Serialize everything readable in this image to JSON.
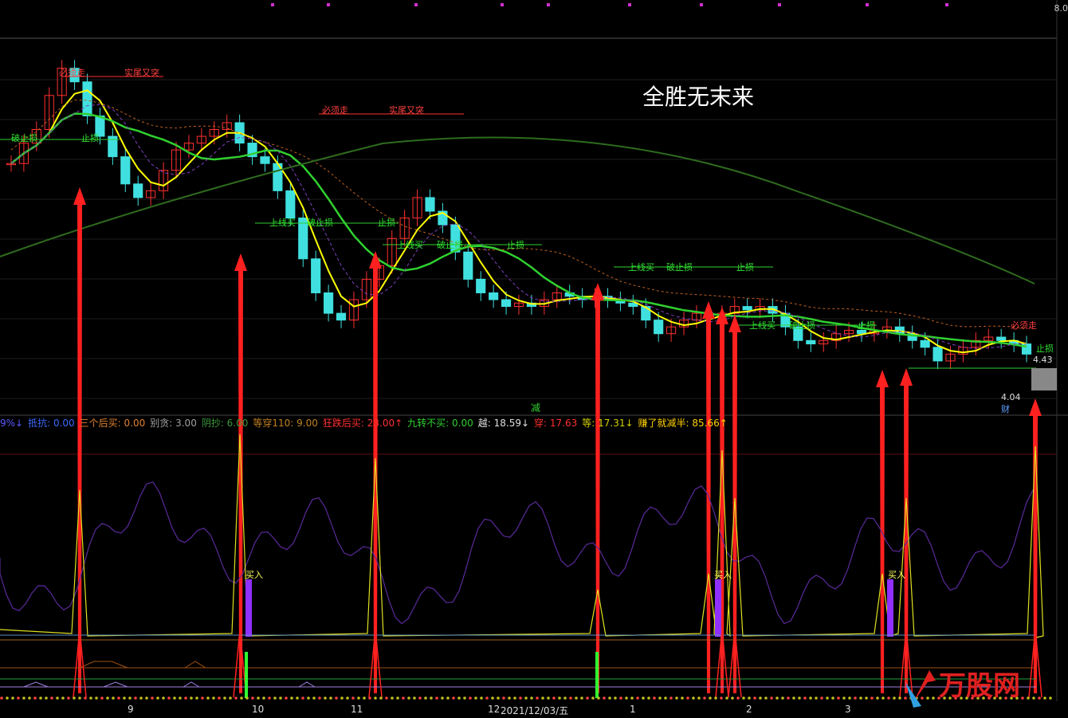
{
  "title": "全胜无末来",
  "top_annotations": [
    "必须走",
    "实尾又突",
    "必须走",
    "实尾又突",
    "必须走"
  ],
  "line_labels": [
    "破止损",
    "止损",
    "上线买",
    "破止损",
    "止损",
    "上线买",
    "破止损",
    "止损",
    "上线买",
    "破止损",
    "止损",
    "上线买",
    "破止损",
    "止损",
    "止损"
  ],
  "legend": [
    {
      "text": "9%↓",
      "color": "#5a5aff"
    },
    {
      "text": "抵抗: 0.00",
      "color": "#3a6bff"
    },
    {
      "text": "三个后买: 0.00",
      "color": "#e08030"
    },
    {
      "text": "别贪: 3.00",
      "color": "#a0a0a0"
    },
    {
      "text": "阴抄: 6.00",
      "color": "#3a9a3a"
    },
    {
      "text": "等穿110: 9.00",
      "color": "#c08020"
    },
    {
      "text": "狂跌后买: 23.00↑",
      "color": "#ff3030"
    },
    {
      "text": "九转不买: 0.00",
      "color": "#30d030"
    },
    {
      "text": "越: 18.59↓",
      "color": "#e0e0e0"
    },
    {
      "text": "穿: 17.63",
      "color": "#ff3030"
    },
    {
      "text": "等: 17.31↓",
      "color": "#d0d000"
    },
    {
      "text": "赚了就减半: 85.66↑",
      "color": "#ffd000"
    }
  ],
  "panel_labels": {
    "jian": "减",
    "buy": "买入",
    "cai": "财"
  },
  "axis": {
    "x_ticks": [
      "9",
      "10",
      "11",
      "12",
      "2021/12/03/五",
      "1",
      "2",
      "3"
    ],
    "right_top": "8.0",
    "last_price": "4.43",
    "low_price": "4.04"
  },
  "colors": {
    "up": "#ff3030",
    "down": "#40e0e0",
    "ma_yellow": "#ffff00",
    "ma_green": "#30d030",
    "ma_dark": "#2e6b1e",
    "buy_arrow": "#ff2020"
  },
  "chart_data": {
    "type": "candlestick",
    "x_ticks": [
      "9",
      "10",
      "11",
      "12",
      "2021/12/03/五",
      "1",
      "2",
      "3"
    ],
    "buy_signals": 9,
    "close": [
      6.9,
      7.2,
      7.4,
      7.9,
      8.3,
      8.1,
      7.6,
      7.3,
      7.0,
      6.6,
      6.4,
      6.5,
      6.8,
      7.1,
      7.2,
      7.3,
      7.4,
      7.5,
      7.2,
      7.0,
      6.9,
      6.5,
      6.1,
      5.5,
      5.0,
      4.7,
      4.6,
      4.9,
      5.2,
      5.4,
      5.8,
      6.1,
      6.4,
      6.2,
      6.0,
      5.6,
      5.2,
      5.0,
      4.9,
      4.8,
      4.85,
      4.8,
      4.9,
      5.0,
      4.95,
      4.9,
      4.95,
      4.9,
      4.85,
      4.8,
      4.6,
      4.4,
      4.5,
      4.6,
      4.7,
      4.65,
      4.7,
      4.8,
      4.75,
      4.8,
      4.7,
      4.5,
      4.3,
      4.25,
      4.3,
      4.4,
      4.45,
      4.4,
      4.45,
      4.5,
      4.4,
      4.3,
      4.2,
      4.0,
      4.1,
      4.2,
      4.3,
      4.35,
      4.3,
      4.25,
      4.1
    ]
  }
}
